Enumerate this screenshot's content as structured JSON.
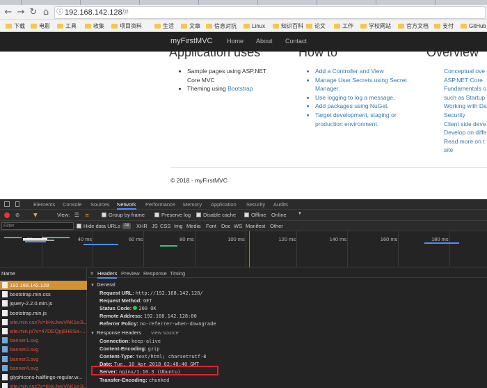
{
  "browser": {
    "address": "192.168.142.128",
    "address_hash": "/#",
    "bookmarks": [
      "下载",
      "电影",
      "工具",
      "收集",
      "项目资料",
      "生活",
      "文章",
      "信息对抗",
      "Linux",
      "知识百科",
      "论文",
      "工作",
      "学校网站",
      "官方文档",
      "支付",
      "GitHub"
    ]
  },
  "site": {
    "brand": "myFirstMVC",
    "nav": [
      "Home",
      "About",
      "Contact"
    ],
    "columns": [
      {
        "heading": "Application uses",
        "items": [
          "Sample pages using ASP.NET Core MVC",
          "Theming using Bootstrap"
        ]
      },
      {
        "heading": "How to",
        "items": [
          "Add a Controller and View",
          "Manage User Secrets using Secret Manager.",
          "Use logging to log a message.",
          "Add packages using NuGet.",
          "Target development, staging or production environment."
        ]
      },
      {
        "heading": "Overview",
        "items": [
          "Conceptual ove",
          "ASP.NET Core",
          "Fundamentals o",
          "such as Startup",
          "Working with Da",
          "Security",
          "Client side deve",
          "Develop on diffe",
          "Read more on t",
          "site"
        ]
      }
    ],
    "theming_prefix": "Theming using ",
    "theming_link": "Bootstrap",
    "footer": "© 2018 - myFirstMVC"
  },
  "devtools": {
    "tabs": [
      "Elements",
      "Console",
      "Sources",
      "Network",
      "Performance",
      "Memory",
      "Application",
      "Security",
      "Audits"
    ],
    "active_tab": "Network",
    "toolbar": {
      "view": "View:",
      "group": "Group by frame",
      "preserve": "Preserve log",
      "disable_cache": "Disable cache",
      "offline": "Offline",
      "online": "Online"
    },
    "filter_placeholder": "Filter",
    "hide_data_urls": "Hide data URLs",
    "regex_label": "All",
    "types": [
      "XHR",
      "JS",
      "CSS",
      "Img",
      "Media",
      "Font",
      "Doc",
      "WS",
      "Manifest",
      "Other"
    ],
    "ticks": [
      "20 ms",
      "40 ms",
      "60 ms",
      "80 ms",
      "100 ms",
      "120 ms",
      "140 ms",
      "160 ms",
      "180 ms"
    ],
    "list_header": "Name",
    "requests": [
      {
        "name": "192.168.142.128",
        "kind": "doc",
        "selected": true,
        "error": false
      },
      {
        "name": "bootstrap.min.css",
        "kind": "doc",
        "selected": false,
        "error": false
      },
      {
        "name": "jquery-2.2.0.min.js",
        "kind": "doc",
        "selected": false,
        "error": false
      },
      {
        "name": "bootstrap.min.js",
        "kind": "doc",
        "selected": false,
        "error": false
      },
      {
        "name": "site.min.css?v=kHvJwvVAK1eJL...",
        "kind": "doc",
        "selected": false,
        "error": true
      },
      {
        "name": "site.min.js?v=47DEQpj8HBSa-...",
        "kind": "doc",
        "selected": false,
        "error": true
      },
      {
        "name": "banner1.svg",
        "kind": "img",
        "selected": false,
        "error": true
      },
      {
        "name": "banner2.svg",
        "kind": "img",
        "selected": false,
        "error": true
      },
      {
        "name": "banner3.svg",
        "kind": "img",
        "selected": false,
        "error": true
      },
      {
        "name": "banner4.svg",
        "kind": "img",
        "selected": false,
        "error": true
      },
      {
        "name": "glyphicons-halflings-regular.w...",
        "kind": "doc",
        "selected": false,
        "error": false
      },
      {
        "name": "site.min.css?v=kHvJwvVAK1eJL...",
        "kind": "doc",
        "selected": false,
        "error": true
      }
    ],
    "detail_tabs": [
      "Headers",
      "Preview",
      "Response",
      "Timing"
    ],
    "general_title": "General",
    "general": [
      {
        "k": "Request URL:",
        "v": "http://192.168.142.128/"
      },
      {
        "k": "Request Method:",
        "v": "GET"
      },
      {
        "k": "Status Code:",
        "v": "200 OK"
      },
      {
        "k": "Remote Address:",
        "v": "192.168.142.128:80"
      },
      {
        "k": "Referrer Policy:",
        "v": "no-referrer-when-downgrade"
      }
    ],
    "response_title": "Response Headers",
    "view_source": "view source",
    "response": [
      {
        "k": "Connection:",
        "v": "keep-alive"
      },
      {
        "k": "Content-Encoding:",
        "v": "gzip"
      },
      {
        "k": "Content-Type:",
        "v": "text/html; charset=utf-8"
      },
      {
        "k": "Date:",
        "v": "Tue, 10 Apr 2018 02:48:40 GMT"
      },
      {
        "k": "Server:",
        "v": "nginx/1.10.3 (Ubuntu)"
      },
      {
        "k": "Transfer-Encoding:",
        "v": "chunked"
      }
    ],
    "colors": {
      "selected_row": "#d49132",
      "error_text": "#e0513a",
      "highlight": "#e0202a"
    }
  }
}
